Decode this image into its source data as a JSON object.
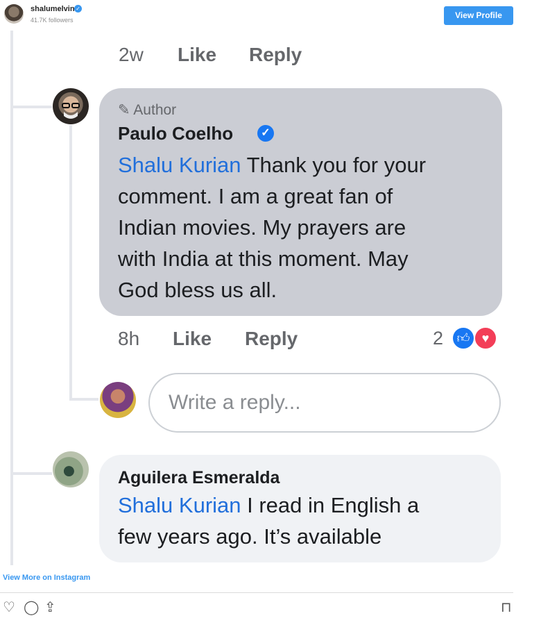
{
  "header": {
    "username": "shalumelvin",
    "followers": "41.7K followers",
    "view_profile": "View Profile"
  },
  "top_actions": {
    "time": "2w",
    "like": "Like",
    "reply": "Reply"
  },
  "author_comment": {
    "badge": "Author",
    "name": "Paulo Coelho",
    "mention": "Shalu Kurian",
    "lines": [
      " Thank you for your",
      "comment. I am a great fan of",
      "Indian movies. My prayers are",
      "with India at this moment. May",
      "God bless us all."
    ],
    "time": "8h",
    "like": "Like",
    "reply": "Reply",
    "reaction_count": "2"
  },
  "reply_box": {
    "placeholder": "Write a reply..."
  },
  "second_comment": {
    "name": "Aguilera Esmeralda",
    "mention": "Shalu Kurian",
    "lines": [
      " I read in English a",
      "few years ago. It’s available"
    ]
  },
  "footer": {
    "view_more": "View More on Instagram"
  },
  "icons": {
    "verified": "verified-badge-icon",
    "pencil": "pencil-icon",
    "like_reaction": "thumbs-up-icon",
    "love_reaction": "heart-icon",
    "footer_like": "heart-outline-icon",
    "footer_comment": "comment-icon",
    "footer_share": "share-icon",
    "footer_save": "bookmark-icon"
  },
  "colors": {
    "instagram_blue": "#3897f0",
    "facebook_blue": "#1877f2",
    "mention_blue": "#216fdb",
    "love_red": "#f33e58"
  }
}
